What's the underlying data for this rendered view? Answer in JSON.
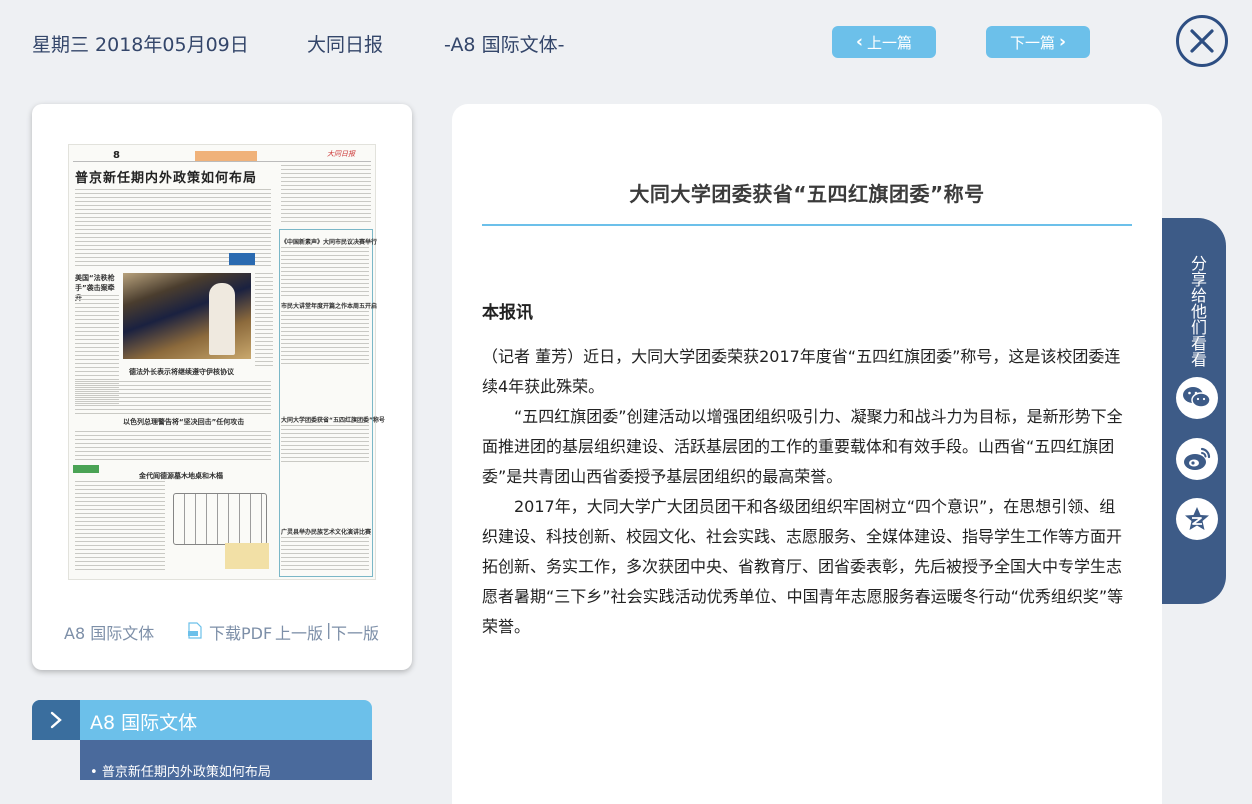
{
  "header": {
    "date": "星期三 2018年05月09日",
    "paper_name": "大同日报",
    "page_label": "-A8 国际文体-",
    "prev_article": "上一篇",
    "next_article": "下一篇"
  },
  "page_card": {
    "thumbnail": {
      "page_number": "8",
      "masthead_logo": "大同日报",
      "headlines": [
        "普京新任期内外政策如何布局",
        "美国“法秩枪手”袭击案牵升",
        "德法外长表示将继续遵守伊核协议",
        "以色列总理警告将“坚决回击”任何攻击",
        "金代阎德源墓木地桌和木榻",
        "《中国新素声》大同市民议决赛举行",
        "市民大讲堂年度开篇之作本周五开启",
        "大同大学团委获省“五四红旗团委”称号",
        "广灵县举办民族艺术文化演讲比赛"
      ]
    },
    "page_label": "A8 国际文体",
    "download_pdf": "下载PDF",
    "prev_page": "上一版",
    "separator": "|",
    "next_page": "下一版"
  },
  "section": {
    "title": "A8  国际文体",
    "items": [
      "普京新任期内外政策如何布局"
    ]
  },
  "article": {
    "title": "大同大学团委获省“五四红旗团委”称号",
    "byline": "本报讯",
    "paragraphs": [
      "（记者 董芳）近日，大同大学团委荣获2017年度省“五四红旗团委”称号，这是该校团委连续4年获此殊荣。",
      "“五四红旗团委”创建活动以增强团组织吸引力、凝聚力和战斗力为目标，是新形势下全面推进团的基层组织建设、活跃基层团的工作的重要载体和有效手段。山西省“五四红旗团委”是共青团山西省委授予基层团组织的最高荣誉。",
      "2017年，大同大学广大团员团干和各级团组织牢固树立“四个意识”，在思想引领、组织建设、科技创新、校园文化、社会实践、志愿服务、全媒体建设、指导学生工作等方面开拓创新、务实工作，多次获团中央、省教育厅、团省委表彰，先后被授予全国大中专学生志愿者暑期“三下乡”社会实践活动优秀单位、中国青年志愿服务春运暖冬行动“优秀组织奖”等荣誉。"
    ]
  },
  "share": {
    "label": "分享给他们看看",
    "icons": [
      "wechat-icon",
      "weibo-icon",
      "qzone-icon"
    ]
  },
  "colors": {
    "accent": "#6cc0ea",
    "dark_blue": "#3d5b87",
    "background": "#eef0f3"
  }
}
